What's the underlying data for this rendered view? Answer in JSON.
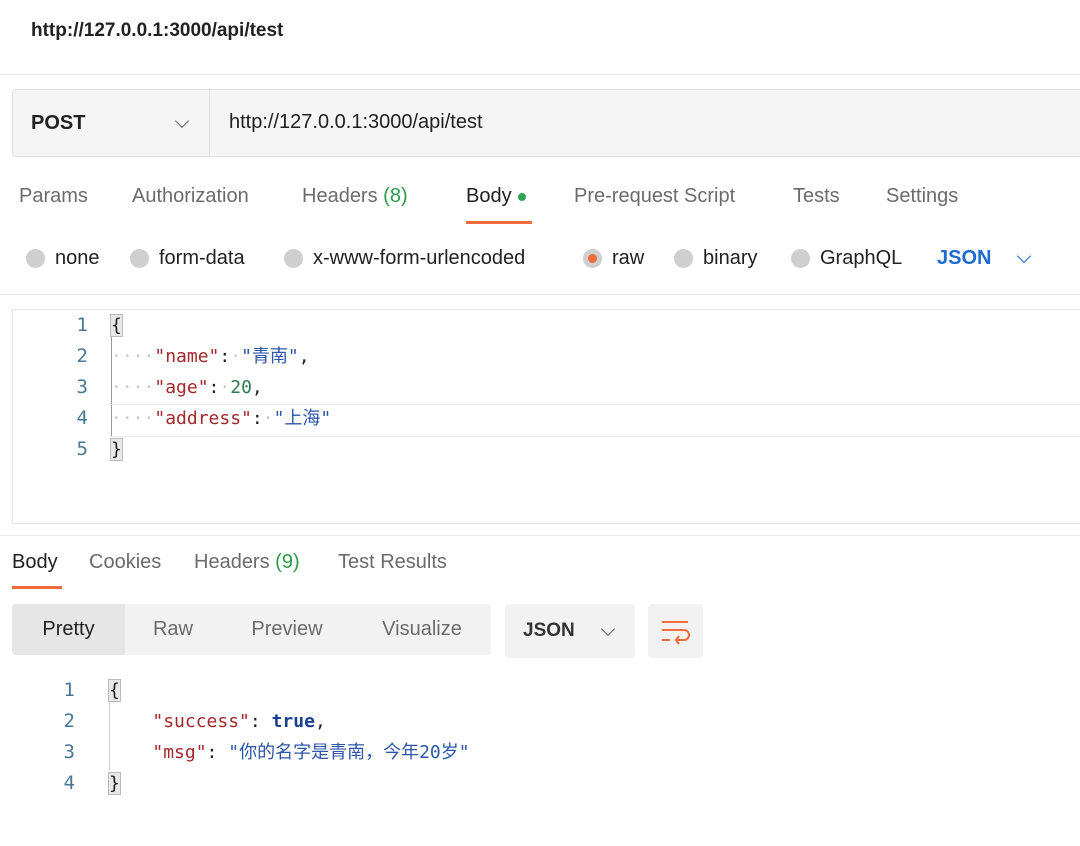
{
  "title": "http://127.0.0.1:3000/api/test",
  "request": {
    "method": "POST",
    "url": "http://127.0.0.1:3000/api/test"
  },
  "tabs": [
    {
      "label": "Params"
    },
    {
      "label": "Authorization"
    },
    {
      "label": "Headers",
      "count": "(8)"
    },
    {
      "label": "Body"
    },
    {
      "label": "Pre-request Script"
    },
    {
      "label": "Tests"
    },
    {
      "label": "Settings"
    }
  ],
  "body_types": [
    "none",
    "form-data",
    "x-www-form-urlencoded",
    "raw",
    "binary",
    "GraphQL"
  ],
  "selected_body_type": "raw",
  "raw_language": "JSON",
  "request_body": {
    "line_numbers": [
      "1",
      "2",
      "3",
      "4",
      "5"
    ],
    "open": "{",
    "close": "}",
    "name_key": "\"name\"",
    "name_val": "\"青南\"",
    "age_key": "\"age\"",
    "age_val": "20",
    "address_key": "\"address\"",
    "address_val": "\"上海\""
  },
  "response_tabs": [
    {
      "label": "Body"
    },
    {
      "label": "Cookies"
    },
    {
      "label": "Headers",
      "count": "(9)"
    },
    {
      "label": "Test Results"
    }
  ],
  "view_modes": [
    "Pretty",
    "Raw",
    "Preview",
    "Visualize"
  ],
  "response_format": "JSON",
  "response_body": {
    "line_numbers": [
      "1",
      "2",
      "3",
      "4"
    ],
    "open": "{",
    "close": "}",
    "success_key": "\"success\"",
    "success_val": "true",
    "msg_key": "\"msg\"",
    "msg_val": "\"你的名字是青南，今年20岁\""
  },
  "colors": {
    "accent": "#f26b3a",
    "link": "#1f6bd1"
  }
}
